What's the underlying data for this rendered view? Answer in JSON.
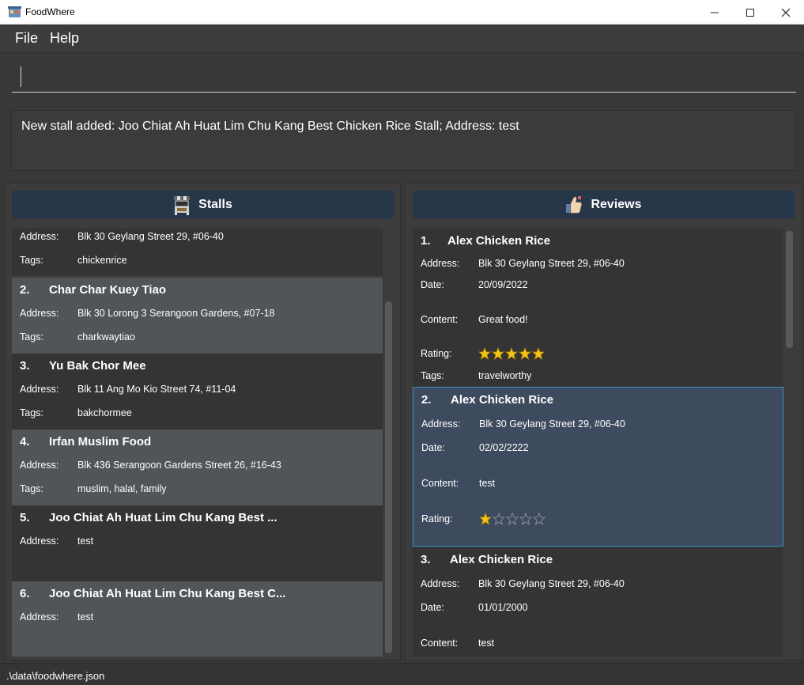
{
  "window": {
    "title": "FoodWhere"
  },
  "menu": {
    "file": "File",
    "help": "Help"
  },
  "command": {
    "value": ""
  },
  "result": {
    "message": "New stall added: Joo Chiat Ah Huat Lim Chu Kang Best Chicken Rice Stall; Address: test"
  },
  "stalls": {
    "header": "Stalls",
    "labels": {
      "address": "Address:",
      "tags": "Tags:"
    },
    "partial": {
      "address": "Blk 30 Geylang Street 29, #06-40",
      "tags": "chickenrice"
    },
    "items": [
      {
        "index": "2.",
        "name": "Char Char Kuey Tiao",
        "address": "Blk 30 Lorong 3 Serangoon Gardens, #07-18",
        "tags": "charkwaytiao"
      },
      {
        "index": "3.",
        "name": "Yu Bak Chor Mee",
        "address": "Blk 11 Ang Mo Kio Street 74, #11-04",
        "tags": "bakchormee"
      },
      {
        "index": "4.",
        "name": "Irfan Muslim Food",
        "address": "Blk 436 Serangoon Gardens Street 26, #16-43",
        "tags": "muslim, halal, family"
      },
      {
        "index": "5.",
        "name": "Joo Chiat Ah Huat Lim Chu Kang Best ...",
        "address": "test"
      },
      {
        "index": "6.",
        "name": "Joo Chiat Ah Huat Lim Chu Kang Best C...",
        "address": "test"
      }
    ]
  },
  "reviews": {
    "header": "Reviews",
    "labels": {
      "address": "Address:",
      "date": "Date:",
      "content": "Content:",
      "rating": "Rating:",
      "tags": "Tags:"
    },
    "items": [
      {
        "index": "1.",
        "name": "Alex Chicken Rice",
        "address": "Blk 30 Geylang Street 29, #06-40",
        "date": "20/09/2022",
        "content": "Great food!",
        "rating": 5,
        "tags": "travelworthy"
      },
      {
        "index": "2.",
        "name": "Alex Chicken Rice",
        "address": "Blk 30 Geylang Street 29, #06-40",
        "date": "02/02/2222",
        "content": "test",
        "rating": 1
      },
      {
        "index": "3.",
        "name": "Alex Chicken Rice",
        "address": "Blk 30 Geylang Street 29, #06-40",
        "date": "01/01/2000",
        "content": "test"
      }
    ]
  },
  "status": {
    "path": ".\\data\\foodwhere.json"
  },
  "colors": {
    "header_bg": "#27374a",
    "selected_border": "#3c8fc0",
    "star": "#f5c518"
  }
}
